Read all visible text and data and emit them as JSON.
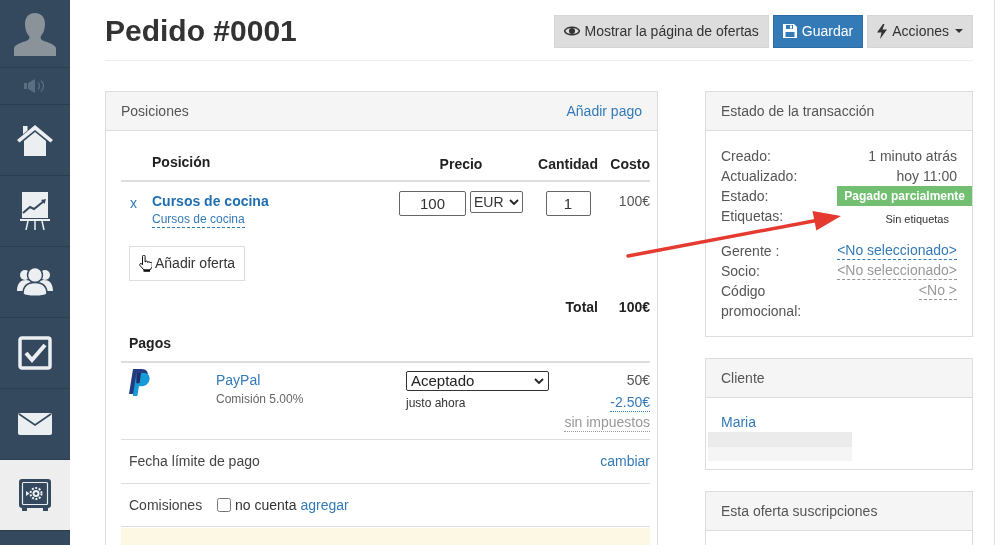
{
  "sidebar": {
    "items": [
      {
        "selected": false
      },
      {
        "selected": false
      },
      {
        "selected": false
      },
      {
        "selected": false
      },
      {
        "selected": false
      },
      {
        "selected": true
      }
    ]
  },
  "header": {
    "title": "Pedido #0001",
    "buttons": [
      {
        "label": "Mostrar la página de ofertas",
        "kind": "default"
      },
      {
        "label": "Guardar",
        "kind": "primary"
      },
      {
        "label": "Acciones",
        "kind": "dropdown"
      }
    ]
  },
  "positions": {
    "title": "Posiciones",
    "action": "Añadir pago",
    "columns": [
      "Posición",
      "Precio",
      "Cantidad",
      "Costo"
    ],
    "rows": [
      {
        "remove": "x",
        "name": "Cursos de cocina",
        "description": "Cursos de cocina",
        "price": "100",
        "currency": "EUR",
        "quantity": "1",
        "cost": "100€"
      }
    ],
    "add_button": "Añadir oferta",
    "total_label": "Total",
    "total": "100€"
  },
  "payments": {
    "title": "Pagos",
    "items": [
      {
        "method": "PayPal",
        "fee": "Comisión 5.00%",
        "status": "Aceptado",
        "time": "justo ahora",
        "amount": "50€",
        "fee_amount": "-2.50€",
        "tax_note": "sin impuestos"
      }
    ],
    "due_date": {
      "label": "Fecha límite de pago",
      "action": "cambiar"
    },
    "commissions": {
      "label": "Comisiones",
      "checked": false,
      "checkbox_label": "no cuenta",
      "action": "agregar"
    }
  },
  "transaction": {
    "title": "Estado de la transacción",
    "fields": [
      {
        "label": "Creado:",
        "value": "1 minuto atrás",
        "kind": "text"
      },
      {
        "label": "Actualizado:",
        "value": "hoy 11:00",
        "kind": "text"
      },
      {
        "label": "Estado:",
        "value": "Pagado parcialmente",
        "kind": "badge"
      },
      {
        "label": "Etiquetas:",
        "value": "Sin etiquetas",
        "kind": "note"
      },
      {
        "label": "Gerente :",
        "value": "<No seleccionado>",
        "kind": "link"
      },
      {
        "label": "Socio:",
        "value": "<No seleccionado>",
        "kind": "muted-link"
      },
      {
        "label": "Código promocional:",
        "value": "<No >",
        "kind": "muted-link"
      }
    ]
  },
  "client": {
    "title": "Cliente",
    "name": "Maria"
  },
  "subscriptions": {
    "title": "Esta oferta suscripciones"
  }
}
